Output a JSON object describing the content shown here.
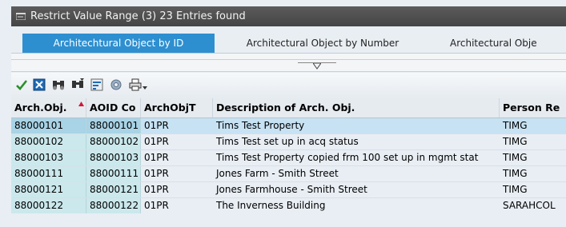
{
  "window": {
    "title": "Restrict Value Range (3)   23 Entries found"
  },
  "tabs": [
    {
      "label": "Architechtural Object by ID",
      "active": true
    },
    {
      "label": "Architectural Object by Number",
      "active": false
    },
    {
      "label": "Architectural Obje",
      "active": false
    }
  ],
  "toolbar": {
    "buttons": [
      {
        "name": "check-icon"
      },
      {
        "name": "cancel-icon"
      },
      {
        "name": "find-icon"
      },
      {
        "name": "find-next-icon"
      },
      {
        "name": "sort-icon"
      },
      {
        "name": "settings-icon"
      },
      {
        "name": "print-icon"
      }
    ]
  },
  "table": {
    "columns": [
      {
        "label": "Arch.Obj."
      },
      {
        "label": "AOID Co"
      },
      {
        "label": "ArchObjT"
      },
      {
        "label": "Description of Arch. Obj."
      },
      {
        "label": "Person Re"
      }
    ],
    "rows": [
      [
        "88000101",
        "88000101",
        "01PR",
        "Tims Test Property",
        "TIMG"
      ],
      [
        "88000102",
        "88000102",
        "01PR",
        "Tims Test set up in acq status",
        "TIMG"
      ],
      [
        "88000103",
        "88000103",
        "01PR",
        "Tims Test Property copied frm 100 set up in mgmt stat",
        "TIMG"
      ],
      [
        "88000111",
        "88000111",
        "01PR",
        "Jones Farm - Smith Street",
        "TIMG"
      ],
      [
        "88000121",
        "88000121",
        "01PR",
        "Jones Farmhouse - Smith Street",
        "TIMG"
      ],
      [
        "88000122",
        "88000122",
        "01PR",
        "The Inverness Building",
        "SARAHCOL"
      ]
    ]
  },
  "colors": {
    "title_bar": "#4f4f4f",
    "active_tab": "#2e8fd0",
    "key_column": "#cbe8ec",
    "selected_row": "#c7e2f3"
  }
}
